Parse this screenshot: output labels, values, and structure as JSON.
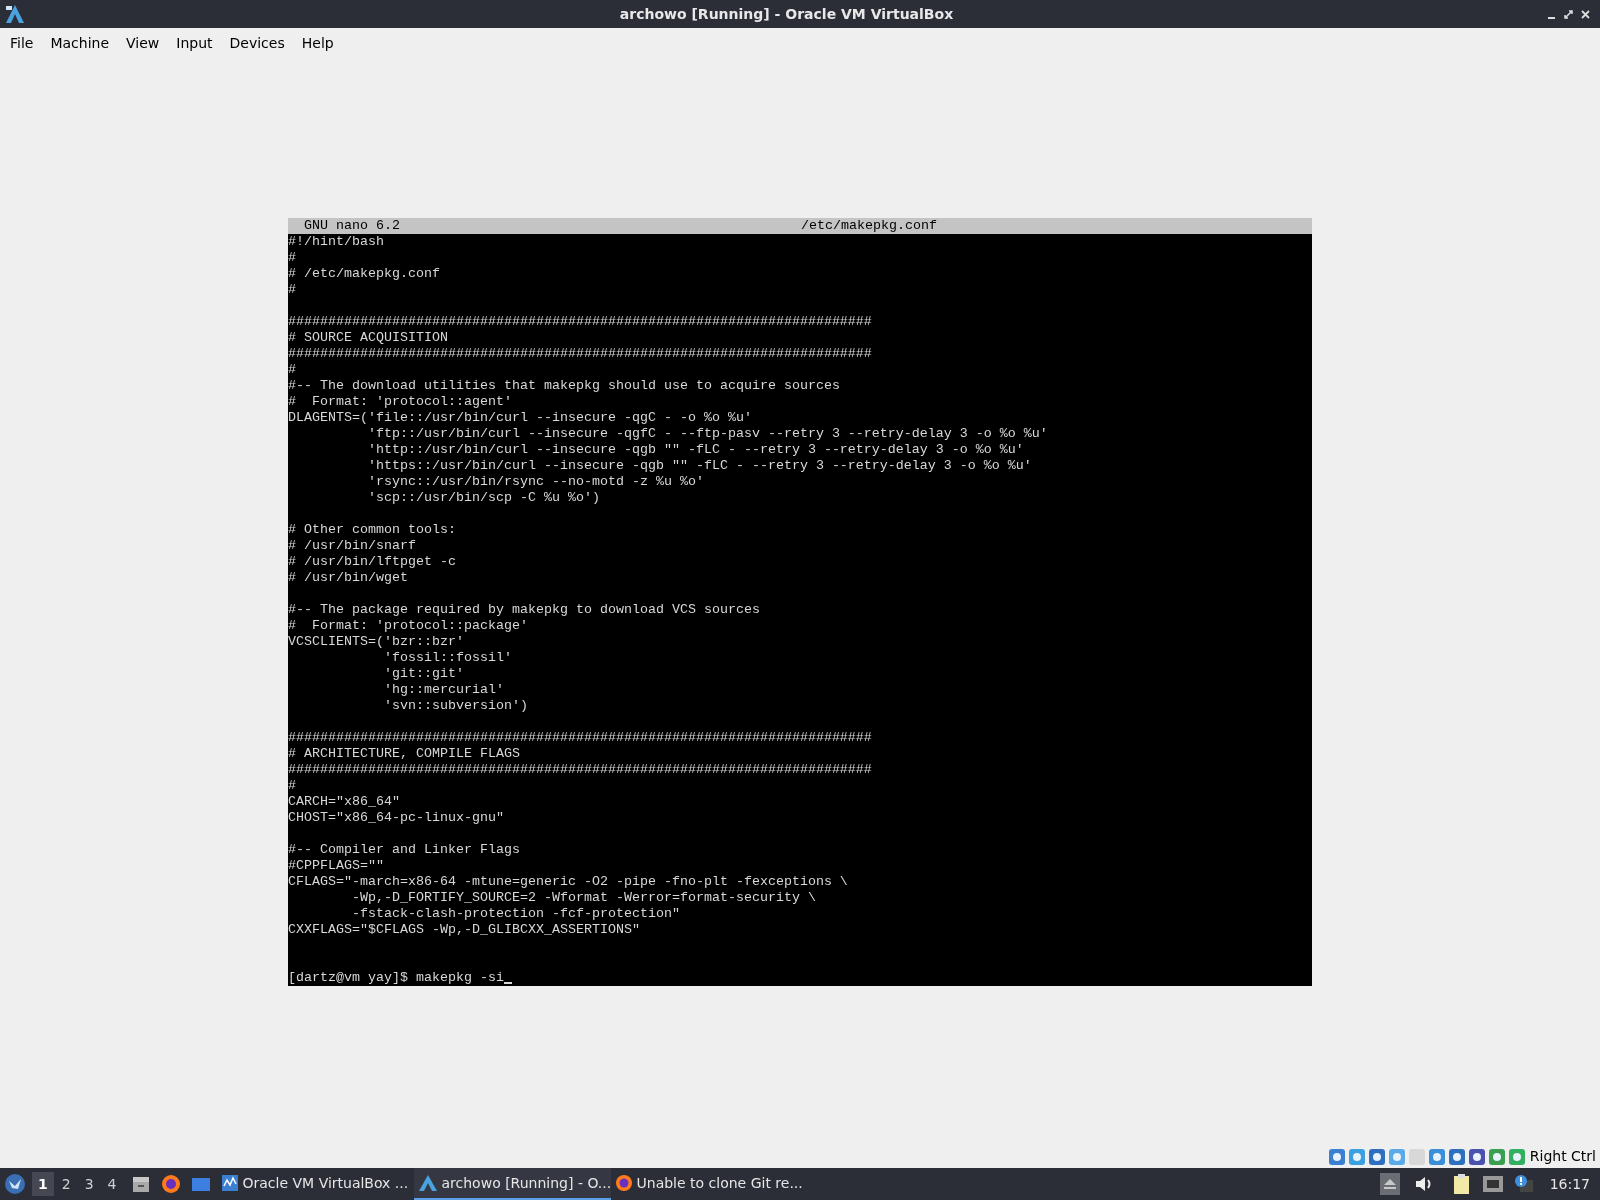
{
  "window": {
    "title": "archowo [Running] - Oracle VM VirtualBox"
  },
  "menu": [
    "File",
    "Machine",
    "View",
    "Input",
    "Devices",
    "Help"
  ],
  "terminal": {
    "header": {
      "app": "GNU nano 6.2",
      "file": "/etc/makepkg.conf"
    },
    "lines": [
      {
        "kind": "text",
        "text": "#!/hint/bash"
      },
      {
        "kind": "text",
        "text": "#"
      },
      {
        "kind": "text",
        "text": "# /etc/makepkg.conf"
      },
      {
        "kind": "text",
        "text": "#"
      },
      {
        "kind": "blank"
      },
      {
        "kind": "text",
        "text": "#########################################################################"
      },
      {
        "kind": "text",
        "text": "# SOURCE ACQUISITION"
      },
      {
        "kind": "text",
        "text": "#########################################################################"
      },
      {
        "kind": "text",
        "text": "#"
      },
      {
        "kind": "text",
        "text": "#-- The download utilities that makepkg should use to acquire sources"
      },
      {
        "kind": "text",
        "text": "#  Format: 'protocol::agent'"
      },
      {
        "kind": "text",
        "text": "DLAGENTS=('file::/usr/bin/curl --insecure -qgC - -o %o %u'"
      },
      {
        "kind": "text",
        "text": "          'ftp::/usr/bin/curl --insecure -qgfC - --ftp-pasv --retry 3 --retry-delay 3 -o %o %u'"
      },
      {
        "kind": "text",
        "text": "          'http::/usr/bin/curl --insecure -qgb \"\" -fLC - --retry 3 --retry-delay 3 -o %o %u'"
      },
      {
        "kind": "text",
        "text": "          'https::/usr/bin/curl --insecure -qgb \"\" -fLC - --retry 3 --retry-delay 3 -o %o %u'"
      },
      {
        "kind": "text",
        "text": "          'rsync::/usr/bin/rsync --no-motd -z %u %o'"
      },
      {
        "kind": "text",
        "text": "          'scp::/usr/bin/scp -C %u %o')"
      },
      {
        "kind": "blank"
      },
      {
        "kind": "text",
        "text": "# Other common tools:"
      },
      {
        "kind": "text",
        "text": "# /usr/bin/snarf"
      },
      {
        "kind": "text",
        "text": "# /usr/bin/lftpget -c"
      },
      {
        "kind": "text",
        "text": "# /usr/bin/wget"
      },
      {
        "kind": "blank"
      },
      {
        "kind": "text",
        "text": "#-- The package required by makepkg to download VCS sources"
      },
      {
        "kind": "text",
        "text": "#  Format: 'protocol::package'"
      },
      {
        "kind": "text",
        "text": "VCSCLIENTS=('bzr::bzr'"
      },
      {
        "kind": "text",
        "text": "            'fossil::fossil'"
      },
      {
        "kind": "text",
        "text": "            'git::git'"
      },
      {
        "kind": "text",
        "text": "            'hg::mercurial'"
      },
      {
        "kind": "text",
        "text": "            'svn::subversion')"
      },
      {
        "kind": "blank"
      },
      {
        "kind": "text",
        "text": "#########################################################################"
      },
      {
        "kind": "text",
        "text": "# ARCHITECTURE, COMPILE FLAGS"
      },
      {
        "kind": "text",
        "text": "#########################################################################"
      },
      {
        "kind": "text",
        "text": "#"
      },
      {
        "kind": "text",
        "text": "CARCH=\"x86_64\""
      },
      {
        "kind": "text",
        "text": "CHOST=\"x86_64-pc-linux-gnu\""
      },
      {
        "kind": "blank"
      },
      {
        "kind": "text",
        "text": "#-- Compiler and Linker Flags"
      },
      {
        "kind": "text",
        "text": "#CPPFLAGS=\"\""
      },
      {
        "kind": "text",
        "text": "CFLAGS=\"-march=x86-64 -mtune=generic -O2 -pipe -fno-plt -fexceptions \\"
      },
      {
        "kind": "text",
        "text": "        -Wp,-D_FORTIFY_SOURCE=2 -Wformat -Werror=format-security \\"
      },
      {
        "kind": "text",
        "text": "        -fstack-clash-protection -fcf-protection\""
      },
      {
        "kind": "text",
        "text": "CXXFLAGS=\"$CFLAGS -Wp,-D_GLIBCXX_ASSERTIONS\""
      },
      {
        "kind": "blank"
      },
      {
        "kind": "blank"
      },
      {
        "kind": "prompt",
        "text": "[dartz@vm yay]$ makepkg -si"
      }
    ]
  },
  "vm_status": {
    "host_key": "Right Ctrl"
  },
  "taskbar": {
    "workspaces": [
      {
        "label": "1",
        "selected": true
      },
      {
        "label": "2",
        "selected": false
      },
      {
        "label": "3",
        "selected": false
      },
      {
        "label": "4",
        "selected": false
      }
    ],
    "tasks": [
      {
        "kind": "manager",
        "title": "Oracle VM VirtualBox ...",
        "selected": false
      },
      {
        "kind": "vm",
        "title": "archowo [Running] - O...",
        "selected": true
      },
      {
        "kind": "browser",
        "title": "Unable to clone Git re...",
        "selected": false
      }
    ],
    "clock": "16:17"
  }
}
